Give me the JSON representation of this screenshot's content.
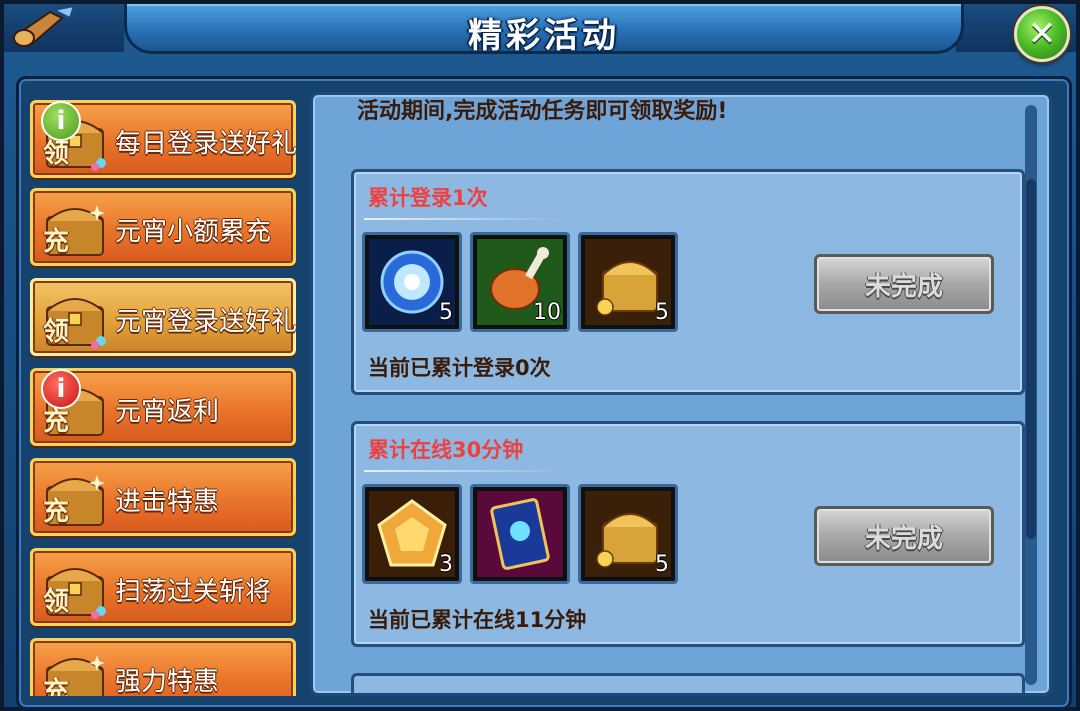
{
  "window": {
    "title": "精彩活动"
  },
  "sidebar": {
    "items": [
      {
        "label": "每日登录送好礼",
        "chest_char": "领",
        "badge": "i",
        "badge_color": "#4a9a1c"
      },
      {
        "label": "元宵小额累充",
        "chest_char": "充"
      },
      {
        "label": "元宵登录送好礼",
        "chest_char": "领",
        "selected": true
      },
      {
        "label": "元宵返利",
        "chest_char": "充",
        "badge": "i",
        "badge_color": "#c81414"
      },
      {
        "label": "进击特惠",
        "chest_char": "充"
      },
      {
        "label": "扫荡过关斩将",
        "chest_char": "领"
      },
      {
        "label": "强力特惠",
        "chest_char": "充"
      }
    ]
  },
  "main": {
    "description": "活动期间,完成活动任务即可领取奖励!",
    "tasks": [
      {
        "title": "累计登录1次",
        "rewards": [
          {
            "icon": "blue-orb-icon",
            "count": "5"
          },
          {
            "icon": "roast-meat-icon",
            "count": "10"
          },
          {
            "icon": "treasure-chest-icon",
            "count": "5"
          }
        ],
        "status": "未完成",
        "progress": "当前已累计登录0次"
      },
      {
        "title": "累计在线30分钟",
        "rewards": [
          {
            "icon": "gold-pentagon-gem-icon",
            "count": "3"
          },
          {
            "icon": "magic-card-icon",
            "count": ""
          },
          {
            "icon": "treasure-chest-icon",
            "count": "5"
          }
        ],
        "status": "未完成",
        "progress": "当前已累计在线11分钟"
      }
    ]
  },
  "colors": {
    "task_title": "#ef4040",
    "sidebar_item": "#e9742a",
    "close_button": "#4fbe2a"
  }
}
